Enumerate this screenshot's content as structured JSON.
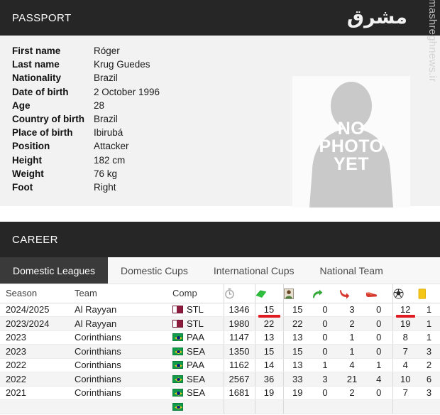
{
  "passport": {
    "header_title": "PASSPORT",
    "watermark_logo": "مشرق",
    "watermark_url": "mashreghnews.ir",
    "fields": [
      {
        "label": "First name",
        "value": "Róger"
      },
      {
        "label": "Last name",
        "value": "Krug Guedes"
      },
      {
        "label": "Nationality",
        "value": "Brazil"
      },
      {
        "label": "Date of birth",
        "value": "2 October 1996"
      },
      {
        "label": "Age",
        "value": "28"
      },
      {
        "label": "Country of birth",
        "value": "Brazil"
      },
      {
        "label": "Place of birth",
        "value": "Ibirubá"
      },
      {
        "label": "Position",
        "value": "Attacker"
      },
      {
        "label": "Height",
        "value": "182 cm"
      },
      {
        "label": "Weight",
        "value": "76 kg"
      },
      {
        "label": "Foot",
        "value": "Right"
      }
    ],
    "photo": {
      "line1": "NO",
      "line2": "PHOTO",
      "line3": "YET"
    }
  },
  "career": {
    "header_title": "CAREER",
    "tabs": [
      {
        "label": "Domestic Leagues",
        "active": true
      },
      {
        "label": "Domestic Cups",
        "active": false
      },
      {
        "label": "International Cups",
        "active": false
      },
      {
        "label": "National Team",
        "active": false
      }
    ],
    "columns": {
      "season": "Season",
      "team": "Team",
      "comp": "Comp",
      "icons": [
        "stopwatch-minutes-icon",
        "green-pitch-appearances-icon",
        "player-starts-icon",
        "green-arrow-sub-in-icon",
        "red-arrow-sub-out-icon",
        "boot-assists-icon",
        "football-goals-icon",
        "yellow-card-icon"
      ]
    },
    "rows": [
      {
        "season": "2024/2025",
        "team": "Al Rayyan",
        "flag": "qa",
        "comp": "STL",
        "minutes": "1346",
        "apps": "15",
        "starts": "15",
        "sub_in": "0",
        "sub_out": "3",
        "assists": "0",
        "goals": "12",
        "yellow": "1",
        "highlight": [
          "apps",
          "goals"
        ]
      },
      {
        "season": "2023/2024",
        "team": "Al Rayyan",
        "flag": "qa",
        "comp": "STL",
        "minutes": "1980",
        "apps": "22",
        "starts": "22",
        "sub_in": "0",
        "sub_out": "2",
        "assists": "0",
        "goals": "19",
        "yellow": "1",
        "highlight": []
      },
      {
        "season": "2023",
        "team": "Corinthians",
        "flag": "br",
        "comp": "PAA",
        "minutes": "1147",
        "apps": "13",
        "starts": "13",
        "sub_in": "0",
        "sub_out": "1",
        "assists": "0",
        "goals": "8",
        "yellow": "1",
        "highlight": []
      },
      {
        "season": "2023",
        "team": "Corinthians",
        "flag": "br",
        "comp": "SEA",
        "minutes": "1350",
        "apps": "15",
        "starts": "15",
        "sub_in": "0",
        "sub_out": "1",
        "assists": "0",
        "goals": "7",
        "yellow": "3",
        "highlight": []
      },
      {
        "season": "2022",
        "team": "Corinthians",
        "flag": "br",
        "comp": "PAA",
        "minutes": "1162",
        "apps": "14",
        "starts": "13",
        "sub_in": "1",
        "sub_out": "4",
        "assists": "1",
        "goals": "4",
        "yellow": "2",
        "highlight": []
      },
      {
        "season": "2022",
        "team": "Corinthians",
        "flag": "br",
        "comp": "SEA",
        "minutes": "2567",
        "apps": "36",
        "starts": "33",
        "sub_in": "3",
        "sub_out": "21",
        "assists": "4",
        "goals": "10",
        "yellow": "6",
        "highlight": []
      },
      {
        "season": "2021",
        "team": "Corinthians",
        "flag": "br",
        "comp": "SEA",
        "minutes": "1681",
        "apps": "19",
        "starts": "19",
        "sub_in": "0",
        "sub_out": "2",
        "assists": "0",
        "goals": "7",
        "yellow": "3",
        "highlight": []
      }
    ]
  },
  "colors": {
    "header_bg": "#262626",
    "active_tab_bg": "#3a3a3a",
    "annotation_red": "#e01b22",
    "panel_bg": "#f2f2f2"
  }
}
